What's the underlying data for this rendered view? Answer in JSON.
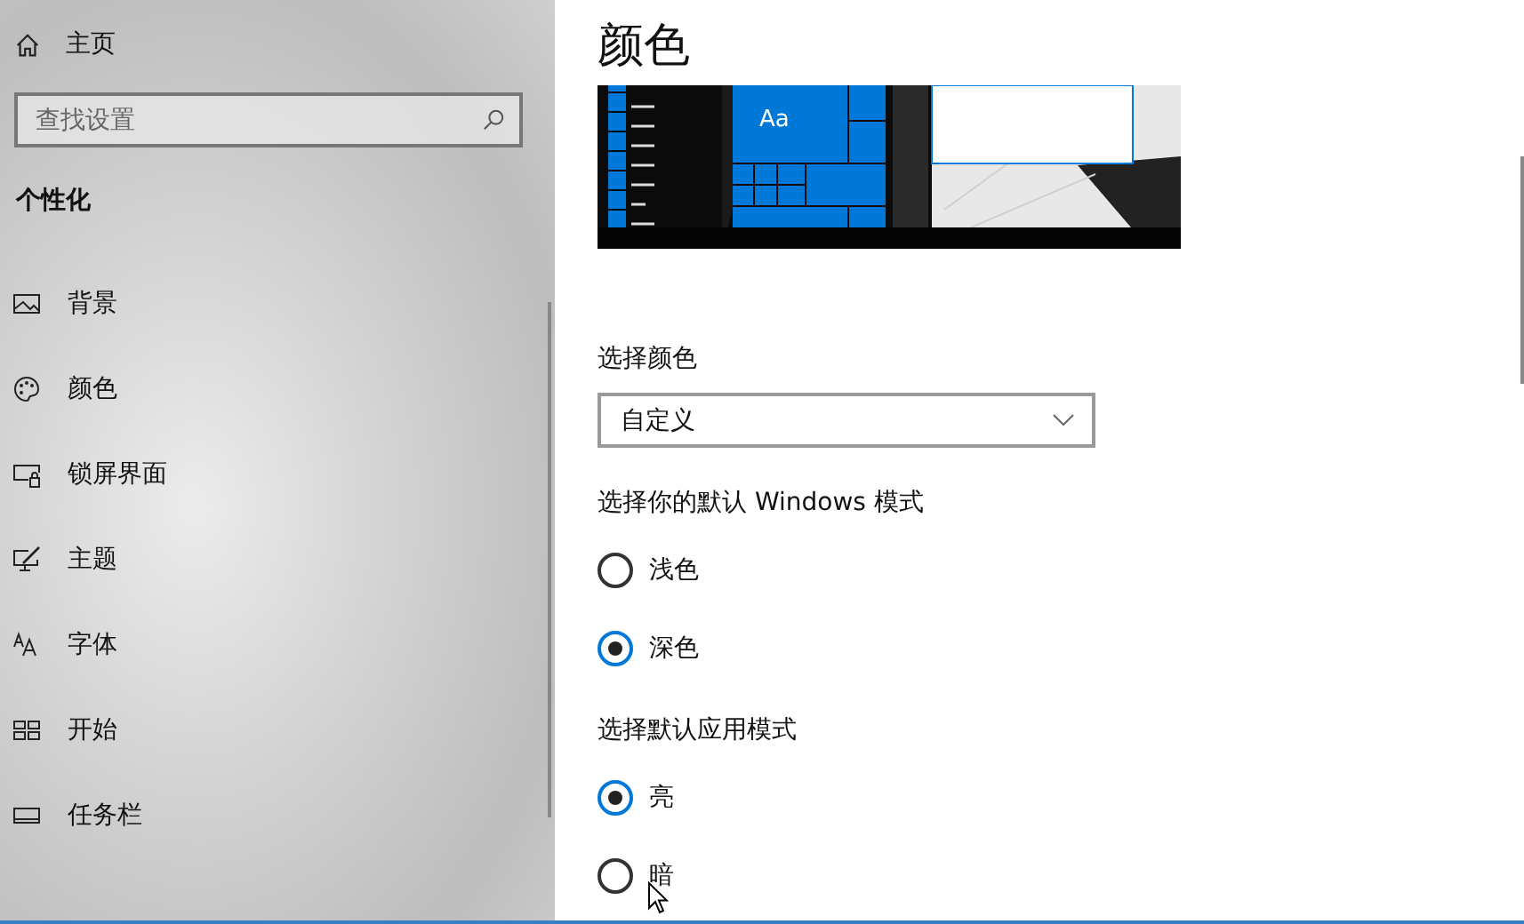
{
  "sidebar": {
    "home": {
      "label": "主页"
    },
    "search": {
      "placeholder": "查找设置"
    },
    "section_title": "个性化",
    "items": [
      {
        "kind": "background",
        "label": "背景"
      },
      {
        "kind": "colors",
        "label": "颜色"
      },
      {
        "kind": "lockscreen",
        "label": "锁屏界面"
      },
      {
        "kind": "themes",
        "label": "主题"
      },
      {
        "kind": "fonts",
        "label": "字体"
      },
      {
        "kind": "start",
        "label": "开始"
      },
      {
        "kind": "taskbar",
        "label": "任务栏"
      }
    ]
  },
  "main": {
    "title": "颜色",
    "preview": {
      "tile_label": "Aa"
    },
    "color_select": {
      "label": "选择颜色",
      "value": "自定义"
    },
    "groups": [
      {
        "label": "选择你的默认 Windows 模式",
        "options": [
          {
            "label": "浅色",
            "selected": false
          },
          {
            "label": "深色",
            "selected": true
          }
        ]
      },
      {
        "label": "选择默认应用模式",
        "options": [
          {
            "label": "亮",
            "selected": true
          },
          {
            "label": "暗",
            "selected": false
          }
        ]
      }
    ]
  }
}
